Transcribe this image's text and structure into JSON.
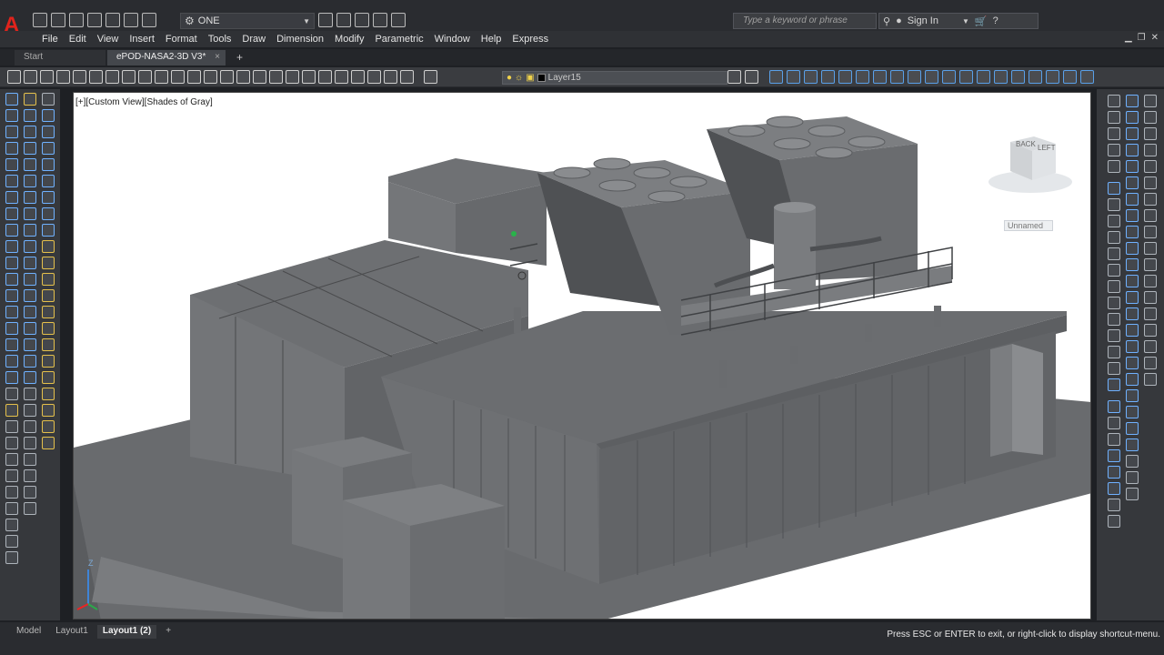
{
  "app": {
    "logo_letter": "A",
    "workspace": "ONE"
  },
  "search": {
    "placeholder": "Type a keyword or phrase"
  },
  "account": {
    "signin_label": "Sign In"
  },
  "menu": [
    "File",
    "Edit",
    "View",
    "Insert",
    "Format",
    "Tools",
    "Draw",
    "Dimension",
    "Modify",
    "Parametric",
    "Window",
    "Help",
    "Express"
  ],
  "doc_tabs": {
    "start": "Start",
    "active": "ePOD-NASA2-3D V3*",
    "close": "×",
    "add": "+"
  },
  "layer": {
    "current": "Layer15"
  },
  "viewport": {
    "view_label": "[+][Custom View][Shades of Gray]",
    "viewcube": {
      "face_back": "BACK",
      "face_left": "LEFT"
    },
    "ucs_name": "Unnamed",
    "ucs_axis_label": "Z"
  },
  "layout_tabs": [
    "Model",
    "Layout1",
    "Layout1 (2)",
    "+"
  ],
  "layout_active_index": 2,
  "command_prompt": "Press ESC or ENTER to exit, or right-click to display shortcut-menu.",
  "colors": {
    "accent_red": "#e0231c",
    "model_dark": "#5c5e61",
    "model_mid": "#737578",
    "model_light": "#8c8e91"
  }
}
